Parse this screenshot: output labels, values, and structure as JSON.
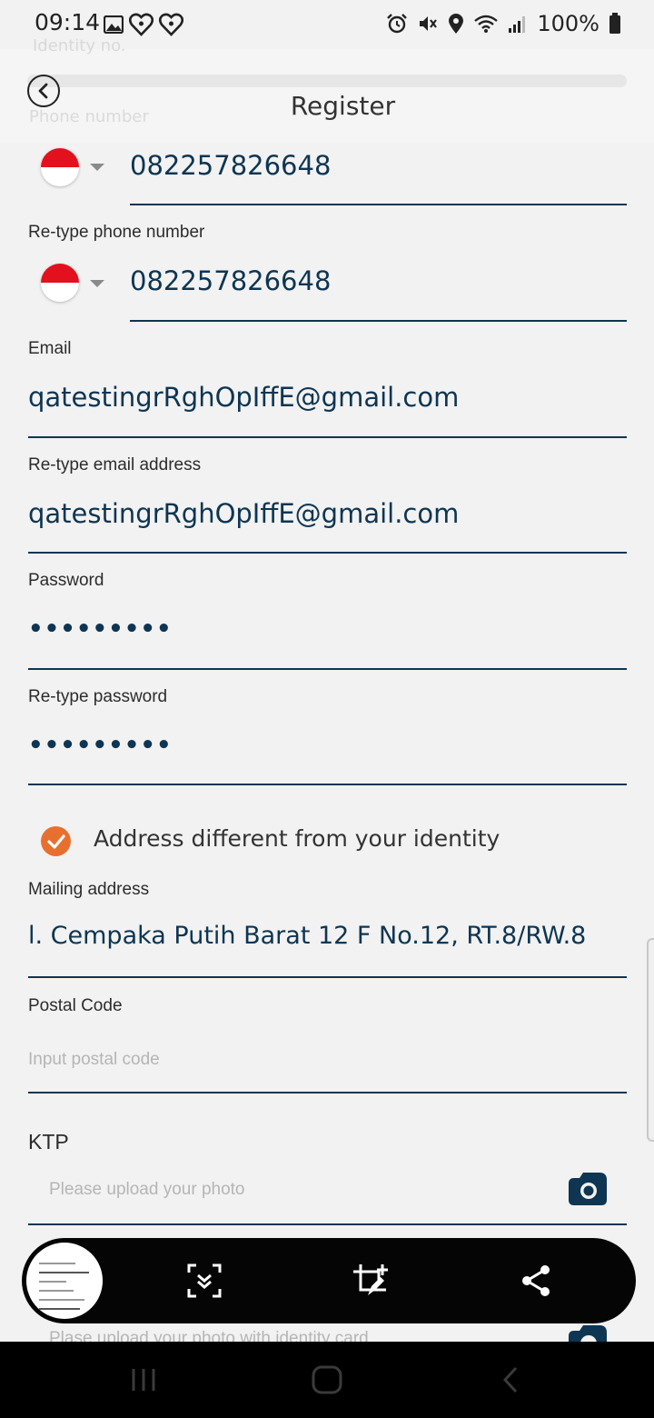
{
  "status_bar": {
    "time": "09:14",
    "battery": "100%",
    "left_icons": [
      "gallery-icon",
      "heart-app-icon",
      "heart-app-icon"
    ],
    "right_icons": [
      "alarm-icon",
      "mute-icon",
      "location-icon",
      "wifi-icon",
      "signal-icon",
      "battery-icon"
    ]
  },
  "header": {
    "title": "Register"
  },
  "ghost_header": {
    "line1": "Identity no.",
    "line2": "Phone number"
  },
  "form": {
    "phone": {
      "value": "082257826648"
    },
    "retype_phone": {
      "label": "Re-type phone number",
      "value": "082257826648"
    },
    "email": {
      "label": "Email",
      "value": "qatestingrRghOpIffE@gmail.com"
    },
    "retype_email": {
      "label": "Re-type email address",
      "value": "qatestingrRghOpIffE@gmail.com"
    },
    "password": {
      "label": "Password",
      "value": "•••••••••"
    },
    "retype_password": {
      "label": "Re-type password",
      "value": "•••••••••"
    },
    "address_checkbox": {
      "label": "Address different from your identity",
      "checked": true
    },
    "mailing_address": {
      "label": "Mailing address",
      "value": "l. Cempaka Putih Barat 12 F No.12, RT.8/RW.8"
    },
    "postal_code": {
      "label": "Postal Code",
      "placeholder": "Input postal code"
    },
    "ktp": {
      "label": "KTP",
      "placeholder": "Please upload your photo"
    },
    "selfie": {
      "placeholder": "Plase upload your photo with identity card"
    }
  },
  "colors": {
    "primary": "#0e3552",
    "accent": "#e8702f",
    "flag_red": "#e3101e",
    "background": "#f2f2f2"
  },
  "screenshot_toolbar": {
    "buttons": [
      "scroll-capture-icon",
      "crop-edit-icon",
      "share-icon"
    ]
  },
  "nav_bar": {
    "buttons": [
      "recent-apps-icon",
      "home-icon",
      "back-icon"
    ]
  }
}
